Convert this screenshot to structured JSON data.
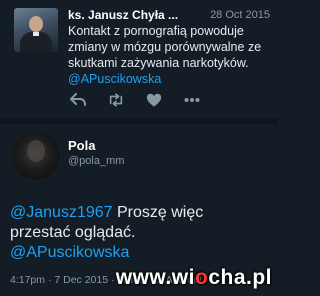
{
  "tweet1": {
    "author_name": "ks. Janusz Chyła ...",
    "date": "28 Oct 2015",
    "text_before": "Kontakt z pornografią powoduje zmiany w mózgu porównywalne ze skutkami zażywania narkotyków. ",
    "mention": "@APuscikowska",
    "actions": {
      "reply_icon": "reply-icon",
      "retweet_icon": "retweet-icon",
      "like_icon": "heart-icon",
      "more_icon": "more-icon"
    }
  },
  "tweet2": {
    "author_name": "Pola",
    "handle": "@pola_mm",
    "mention1": "@Janusz1967",
    "text": " Proszę więc przestać oglądać.",
    "mention2": "@APuscikowska",
    "meta": "4:17pm · 7 Dec 2015 · Twitter for Android"
  },
  "watermark": {
    "part1": "www.wi",
    "part2": "o",
    "part3": "cha.pl"
  },
  "colors": {
    "background": "#141d26",
    "link": "#1da1f2",
    "muted": "#8899a6"
  }
}
